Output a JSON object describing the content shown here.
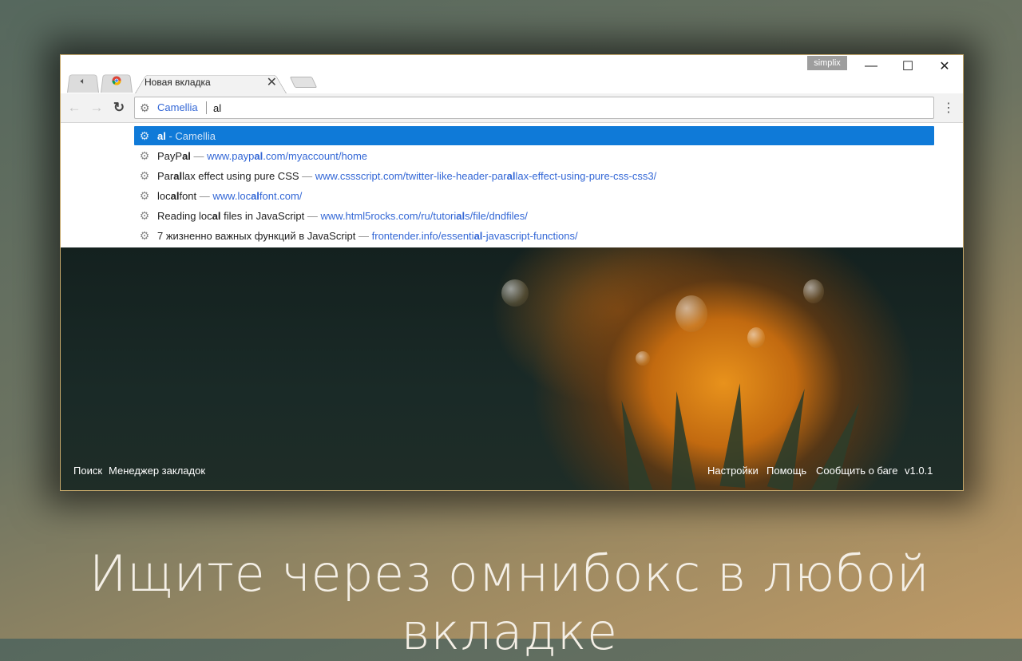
{
  "tabs": {
    "pinned": [
      {
        "icon": "speaker-icon"
      },
      {
        "icon": "chrome-icon"
      }
    ],
    "active_title": "Новая вкладка",
    "close_glyph": "✕"
  },
  "window": {
    "profile_name": "simplix",
    "minimize_glyph": "—",
    "maximize_glyph": "☐",
    "close_glyph": "✕"
  },
  "toolbar": {
    "back_glyph": "←",
    "forward_glyph": "→",
    "reload_glyph": "↻",
    "menu_glyph": "⋮",
    "omnibox": {
      "keyword": "Camellia",
      "value": "al"
    }
  },
  "suggestions": [
    {
      "parts": [
        {
          "t": "al",
          "b": true
        }
      ],
      "sep": " - ",
      "url_parts": [
        {
          "t": "Camellia",
          "b": false
        }
      ],
      "selected": true
    },
    {
      "parts": [
        {
          "t": "PayP",
          "b": false
        },
        {
          "t": "al",
          "b": true
        }
      ],
      "sep": " — ",
      "url_parts": [
        {
          "t": "www.payp",
          "b": false
        },
        {
          "t": "al",
          "b": true
        },
        {
          "t": ".com/myaccount/home",
          "b": false
        }
      ],
      "selected": false
    },
    {
      "parts": [
        {
          "t": "Par",
          "b": false
        },
        {
          "t": "al",
          "b": true
        },
        {
          "t": "lax effect using pure CSS",
          "b": false
        }
      ],
      "sep": " — ",
      "url_parts": [
        {
          "t": "www.cssscript.com/twitter-like-header-par",
          "b": false
        },
        {
          "t": "al",
          "b": true
        },
        {
          "t": "lax-effect-using-pure-css-css3/",
          "b": false
        }
      ],
      "selected": false
    },
    {
      "parts": [
        {
          "t": "loc",
          "b": false
        },
        {
          "t": "al",
          "b": true
        },
        {
          "t": "font",
          "b": false
        }
      ],
      "sep": " — ",
      "url_parts": [
        {
          "t": "www.loc",
          "b": false
        },
        {
          "t": "al",
          "b": true
        },
        {
          "t": "font.com/",
          "b": false
        }
      ],
      "selected": false
    },
    {
      "parts": [
        {
          "t": "Reading loc",
          "b": false
        },
        {
          "t": "al",
          "b": true
        },
        {
          "t": " files in JavaScript",
          "b": false
        }
      ],
      "sep": " — ",
      "url_parts": [
        {
          "t": "www.html5rocks.com/ru/tutori",
          "b": false
        },
        {
          "t": "al",
          "b": true
        },
        {
          "t": "s/file/dndfiles/",
          "b": false
        }
      ],
      "selected": false
    },
    {
      "parts": [
        {
          "t": "7 жизненно важных функций в JavaScript",
          "b": false
        }
      ],
      "sep": " — ",
      "url_parts": [
        {
          "t": "frontender.info/essenti",
          "b": false
        },
        {
          "t": "al",
          "b": true
        },
        {
          "t": "-javascript-functions/",
          "b": false
        }
      ],
      "selected": false
    }
  ],
  "footer": {
    "left": [
      "Поиск",
      "Менеджер закладок"
    ],
    "right": [
      "Настройки",
      "Помощь",
      "Сообщить о баге",
      "v1.0.1"
    ]
  },
  "caption": "Ищите через омнибокс в любой вкладке",
  "colors": {
    "accent": "#0f7ad8",
    "link": "#3367d6"
  }
}
